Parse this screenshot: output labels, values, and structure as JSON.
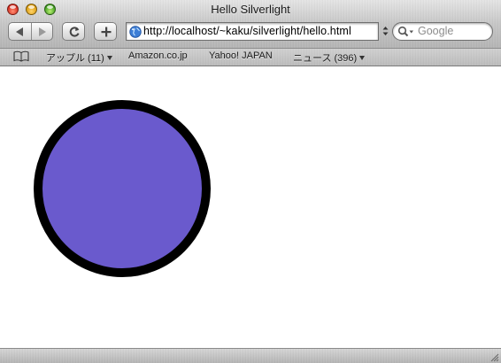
{
  "window": {
    "title": "Hello Silverlight"
  },
  "toolbar": {
    "back_icon": "back-arrow-icon",
    "forward_icon": "forward-arrow-icon",
    "reload_icon": "reload-icon",
    "add_icon": "plus-icon",
    "address": "http://localhost/~kaku/silverlight/hello.html",
    "search_placeholder": "Google"
  },
  "bookmarks": [
    {
      "label": "アップル (11)",
      "has_menu": true
    },
    {
      "label": "Amazon.co.jp",
      "has_menu": false
    },
    {
      "label": "Yahoo! JAPAN",
      "has_menu": false
    },
    {
      "label": "ニュース (396)",
      "has_menu": true
    }
  ],
  "content": {
    "shape": "circle",
    "fill_color": "#6a5acd",
    "stroke_color": "#000000"
  }
}
